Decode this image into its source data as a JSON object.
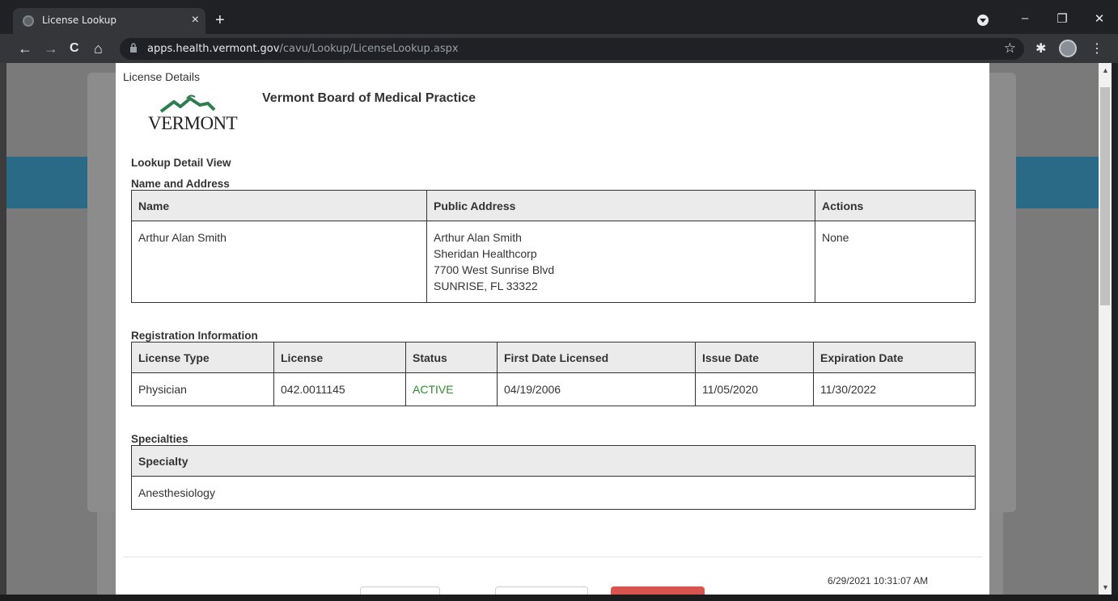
{
  "browser": {
    "tab_title": "License Lookup",
    "tab_close": "×",
    "new_tab": "+",
    "url_domain": "apps.health.vermont.gov",
    "url_path": "/cavu/Lookup/LicenseLookup.aspx",
    "back": "←",
    "forward": "→",
    "reload": "C",
    "home": "⌂",
    "star": "☆",
    "ext_icon": "✱",
    "menu": "⋮",
    "win_min": "–",
    "win_restore": "❐",
    "win_close": "✕"
  },
  "modal": {
    "title": "License Details",
    "logo_text": "VERMONT",
    "board_name": "Vermont Board of Medical Practice",
    "detail_view_label": "Lookup Detail View",
    "name_address_label": "Name and Address",
    "name_address": {
      "headers": [
        "Name",
        "Public Address",
        "Actions"
      ],
      "row": {
        "name": "Arthur Alan Smith",
        "address_lines": [
          "Arthur Alan Smith",
          "Sheridan Healthcorp",
          "7700 West Sunrise Blvd",
          "SUNRISE, FL 33322"
        ],
        "actions": "None"
      }
    },
    "registration_label": "Registration Information",
    "registration": {
      "headers": [
        "License Type",
        "License",
        "Status",
        "First Date Licensed",
        "Issue Date",
        "Expiration Date"
      ],
      "row": [
        "Physician",
        "042.0011145",
        "ACTIVE",
        "04/19/2006",
        "11/05/2020",
        "11/30/2022"
      ]
    },
    "specialties_label": "Specialties",
    "specialties": {
      "header": "Specialty",
      "rows": [
        "Anesthesiology"
      ]
    },
    "timestamp": "6/29/2021 10:31:07 AM"
  },
  "colors": {
    "status_active": "#2e8b2e",
    "header_bg": "#ebebeb",
    "bg_strip": "#2b6a87",
    "red_button": "#d9534f"
  }
}
